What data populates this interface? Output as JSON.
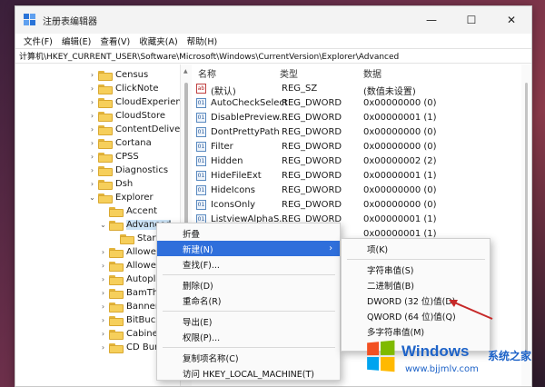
{
  "window": {
    "title": "注册表编辑器",
    "controls": {
      "minimize": "—",
      "maximize": "☐",
      "close": "✕"
    }
  },
  "menubar": [
    "文件(F)",
    "编辑(E)",
    "查看(V)",
    "收藏夹(A)",
    "帮助(H)"
  ],
  "address": "计算机\\HKEY_CURRENT_USER\\Software\\Microsoft\\Windows\\CurrentVersion\\Explorer\\Advanced",
  "tree": {
    "items": [
      {
        "label": "Census",
        "chev": "›"
      },
      {
        "label": "ClickNote",
        "chev": "›"
      },
      {
        "label": "CloudExperienceH",
        "chev": "›"
      },
      {
        "label": "CloudStore",
        "chev": "›"
      },
      {
        "label": "ContentDeliveryM",
        "chev": "›"
      },
      {
        "label": "Cortana",
        "chev": "›"
      },
      {
        "label": "CPSS",
        "chev": "›"
      },
      {
        "label": "Diagnostics",
        "chev": "›"
      },
      {
        "label": "Dsh",
        "chev": "›"
      },
      {
        "label": "Explorer",
        "chev": "⌄"
      },
      {
        "label": "Accent",
        "chev": ""
      },
      {
        "label": "Advanced",
        "chev": "⌄"
      },
      {
        "label": "StartM",
        "chev": ""
      },
      {
        "label": "AllowedE",
        "chev": "›"
      },
      {
        "label": "AllowedP",
        "chev": "›"
      },
      {
        "label": "Autoplay",
        "chev": "›"
      },
      {
        "label": "BamThro",
        "chev": "›"
      },
      {
        "label": "BannerSt",
        "chev": "›"
      },
      {
        "label": "BitBucke",
        "chev": "›"
      },
      {
        "label": "CabinetS",
        "chev": "›"
      },
      {
        "label": "CD Burn",
        "chev": "›"
      }
    ]
  },
  "values": {
    "headers": {
      "name": "名称",
      "type": "类型",
      "data": "数据"
    },
    "rows": [
      {
        "name": "(默认)",
        "type": "REG_SZ",
        "data": "(数值未设置)",
        "icon": "ab"
      },
      {
        "name": "AutoCheckSelect",
        "type": "REG_DWORD",
        "data": "0x00000000 (0)",
        "icon": "01"
      },
      {
        "name": "DisablePreview...",
        "type": "REG_DWORD",
        "data": "0x00000001 (1)",
        "icon": "01"
      },
      {
        "name": "DontPrettyPath",
        "type": "REG_DWORD",
        "data": "0x00000000 (0)",
        "icon": "01"
      },
      {
        "name": "Filter",
        "type": "REG_DWORD",
        "data": "0x00000000 (0)",
        "icon": "01"
      },
      {
        "name": "Hidden",
        "type": "REG_DWORD",
        "data": "0x00000002 (2)",
        "icon": "01"
      },
      {
        "name": "HideFileExt",
        "type": "REG_DWORD",
        "data": "0x00000001 (1)",
        "icon": "01"
      },
      {
        "name": "HideIcons",
        "type": "REG_DWORD",
        "data": "0x00000000 (0)",
        "icon": "01"
      },
      {
        "name": "IconsOnly",
        "type": "REG_DWORD",
        "data": "0x00000000 (0)",
        "icon": "01"
      },
      {
        "name": "ListviewAlphaS...",
        "type": "REG_DWORD",
        "data": "0x00000001 (1)",
        "icon": "01"
      },
      {
        "name": "",
        "type": "",
        "data": "0x00000001 (1)",
        "icon": ""
      }
    ]
  },
  "context_menu": {
    "items": [
      "折叠",
      "新建(N)",
      "查找(F)...",
      "删除(D)",
      "重命名(R)",
      "导出(E)",
      "权限(P)...",
      "复制项名称(C)",
      "访问 HKEY_LOCAL_MACHINE(T)"
    ],
    "submenu_arrow": "›"
  },
  "submenu": {
    "items": [
      "项(K)",
      "字符串值(S)",
      "二进制值(B)",
      "DWORD (32 位)值(D)",
      "QWORD (64 位)值(Q)",
      "多字符串值(M)"
    ]
  },
  "watermark": {
    "title": "Windows",
    "subtitle": "系统之家",
    "url": "www.bjjmlv.com"
  },
  "colors": {
    "highlight": "#2f6fdb",
    "annotation_arrow": "#c62828",
    "selected_tree": "#cce4f7",
    "folder": "#f6cf5b",
    "watermark": "#1e63c8"
  }
}
